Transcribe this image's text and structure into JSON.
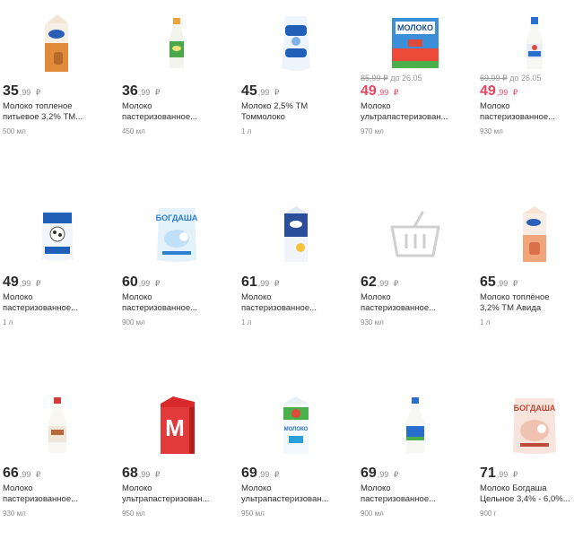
{
  "currency": "₽",
  "products": [
    {
      "int": "35",
      "frac": ",99",
      "name1": "Молоко топленое",
      "name2": "питьевое 3,2% ТМ...",
      "size": "500 мл",
      "icon": "milk-carton-orange-icon",
      "old": "",
      "until": ""
    },
    {
      "int": "36",
      "frac": ",99",
      "name1": "Молоко",
      "name2": "пастеризованное...",
      "size": "450 мл",
      "icon": "milk-bottle-green-icon",
      "old": "",
      "until": ""
    },
    {
      "int": "45",
      "frac": ",99",
      "name1": "Молоко 2,5% ТМ",
      "name2": "Томмолоко",
      "size": "1 л",
      "icon": "milk-pouch-blue-icon",
      "old": "",
      "until": ""
    },
    {
      "int": "49",
      "frac": ",99",
      "name1": "Молоко",
      "name2": "ультрапастеризован...",
      "size": "970 мл",
      "icon": "milk-box-blue-icon",
      "old": "85,99 ₽",
      "until": "до 26.05"
    },
    {
      "int": "49",
      "frac": ",99",
      "name1": "Молоко",
      "name2": "пастеризованное...",
      "size": "930 мл",
      "icon": "milk-bottle-blue-cap-icon",
      "old": "69,99 ₽",
      "until": "до 26.05"
    },
    {
      "int": "49",
      "frac": ",99",
      "name1": "Молоко",
      "name2": "пастеризованное...",
      "size": "1 л",
      "icon": "milk-pouch-cow-icon",
      "old": "",
      "until": ""
    },
    {
      "int": "60",
      "frac": ",99",
      "name1": "Молоко",
      "name2": "пастеризованное...",
      "size": "900 мл",
      "icon": "milk-pouch-bogdasha-icon",
      "old": "",
      "until": ""
    },
    {
      "int": "61",
      "frac": ",99",
      "name1": "Молоко",
      "name2": "пастеризованное...",
      "size": "1 л",
      "icon": "milk-carton-blue-icon",
      "old": "",
      "until": ""
    },
    {
      "int": "62",
      "frac": ",99",
      "name1": "Молоко",
      "name2": "пастеризованное...",
      "size": "930 мл",
      "icon": "basket-placeholder-icon",
      "old": "",
      "until": ""
    },
    {
      "int": "65",
      "frac": ",99",
      "name1": "Молоко топлёное",
      "name2": "3,2% ТМ Авида",
      "size": "1 л",
      "icon": "milk-carton-peach-icon",
      "old": "",
      "until": ""
    },
    {
      "int": "66",
      "frac": ",99",
      "name1": "Молоко",
      "name2": "пастеризованное...",
      "size": "930 мл",
      "icon": "milk-bottle-red-cap-icon",
      "old": "",
      "until": ""
    },
    {
      "int": "68",
      "frac": ",99",
      "name1": "Молоко",
      "name2": "ультрапастеризован...",
      "size": "950 мл",
      "icon": "milk-box-red-icon",
      "old": "",
      "until": ""
    },
    {
      "int": "69",
      "frac": ",99",
      "name1": "Молоко",
      "name2": "ультрапастеризован...",
      "size": "950 мл",
      "icon": "milk-box-village-icon",
      "old": "",
      "until": ""
    },
    {
      "int": "69",
      "frac": ",99",
      "name1": "Молоко",
      "name2": "пастеризованное...",
      "size": "900 мл",
      "icon": "milk-bottle-blue-label-icon",
      "old": "",
      "until": ""
    },
    {
      "int": "71",
      "frac": ",99",
      "name1": "Молоко Богдаша",
      "name2": "Цельное 3,4% - 6,0%...",
      "size": "900 г",
      "icon": "milk-pouch-pink-icon",
      "old": "",
      "until": ""
    }
  ]
}
